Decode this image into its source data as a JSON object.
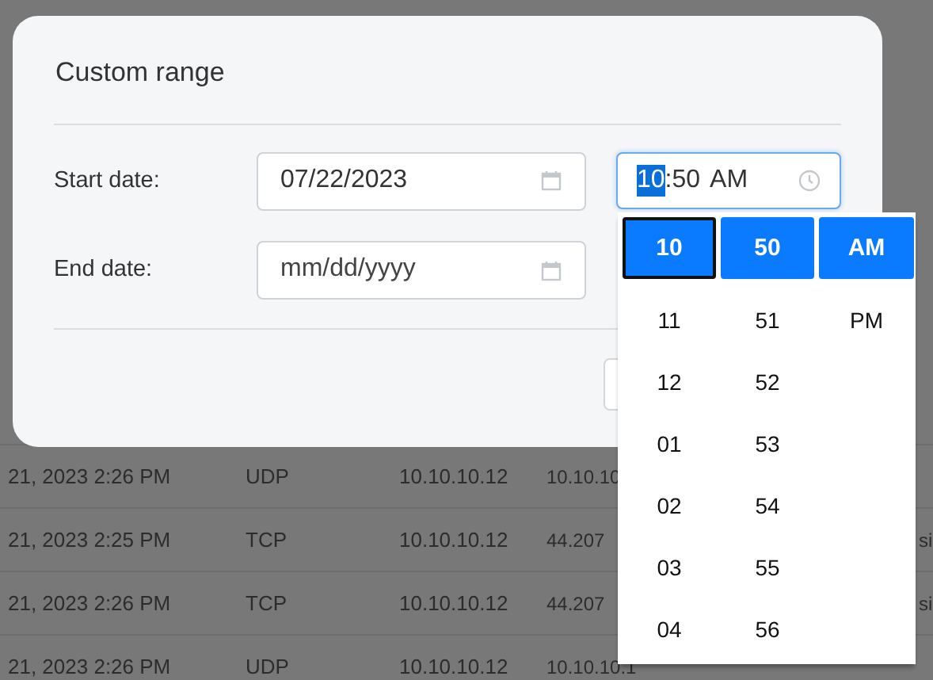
{
  "background_table": {
    "rows": [
      {
        "time": "21, 2023 2:26 PM",
        "protocol": "UDP",
        "source": "10.10.10.12",
        "column_4": "10.10.10"
      },
      {
        "time": "21, 2023 2:25 PM",
        "protocol": "TCP",
        "source": "10.10.10.12",
        "column_4": "44.207",
        "column_6": "si"
      },
      {
        "time": "21, 2023 2:26 PM",
        "protocol": "TCP",
        "source": "10.10.10.12",
        "column_4": "44.207",
        "column_6": "si"
      },
      {
        "time": "21, 2023 2:26 PM",
        "protocol": "UDP",
        "source": "10.10.10.12",
        "column_4": "10.10.10.1"
      }
    ]
  },
  "dialog": {
    "title": "Custom range",
    "start_date": {
      "label": "Start date:",
      "value": "07/22/2023",
      "time": {
        "segments": [
          {
            "text": "10",
            "selected": true
          },
          {
            "text": ":50",
            "selected": false
          },
          {
            "text": "AM",
            "selected": false
          }
        ]
      }
    },
    "end_date": {
      "label": "End date:",
      "placeholder": "mm/dd/yyyy"
    }
  },
  "time_picker": {
    "columns": [
      {
        "focused": true,
        "items": [
          {
            "text": "10",
            "selected": true
          },
          {
            "text": "11",
            "selected": false
          },
          {
            "text": "12",
            "selected": false
          },
          {
            "text": "01",
            "selected": false
          },
          {
            "text": "02",
            "selected": false
          },
          {
            "text": "03",
            "selected": false
          },
          {
            "text": "04",
            "selected": false
          }
        ]
      },
      {
        "focused": false,
        "items": [
          {
            "text": "50",
            "selected": true
          },
          {
            "text": "51",
            "selected": false
          },
          {
            "text": "52",
            "selected": false
          },
          {
            "text": "53",
            "selected": false
          },
          {
            "text": "54",
            "selected": false
          },
          {
            "text": "55",
            "selected": false
          },
          {
            "text": "56",
            "selected": false
          }
        ]
      },
      {
        "focused": false,
        "items": [
          {
            "text": "AM",
            "selected": true
          },
          {
            "text": "PM",
            "selected": false
          }
        ]
      }
    ]
  }
}
